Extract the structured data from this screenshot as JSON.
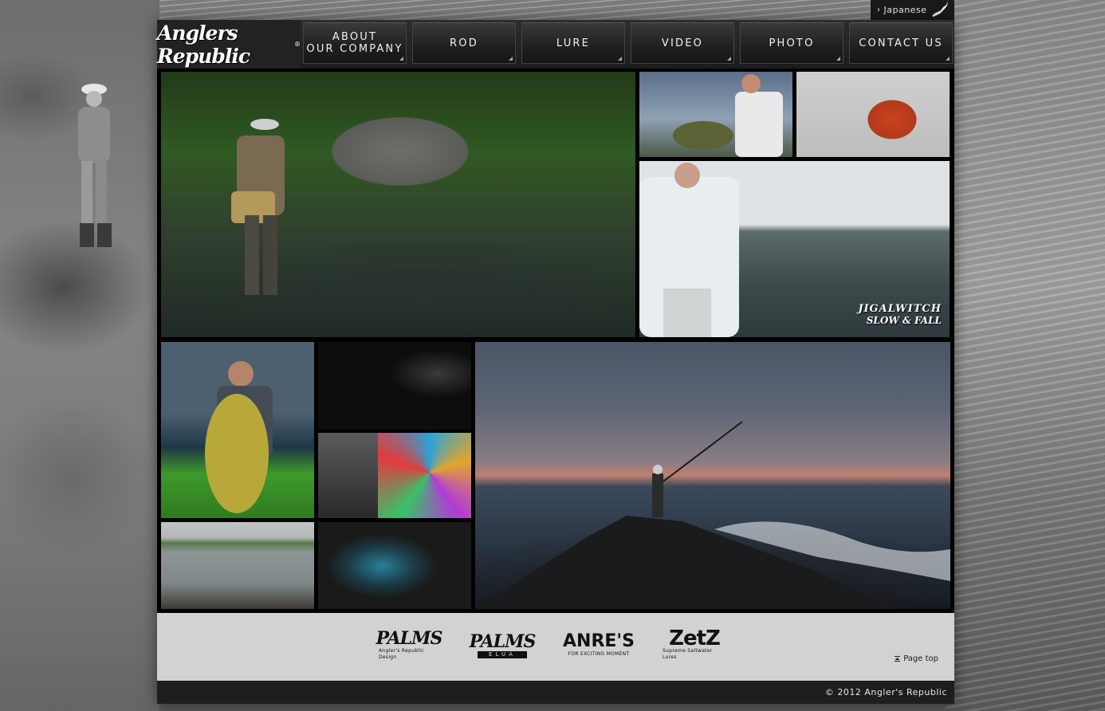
{
  "language_switch": {
    "label": "Japanese"
  },
  "header": {
    "logo_text": "Anglers Republic",
    "logo_mark": "®"
  },
  "nav": {
    "items": [
      {
        "label": "ABOUT\nOUR COMPANY"
      },
      {
        "label": "ROD"
      },
      {
        "label": "LURE"
      },
      {
        "label": "VIDEO"
      },
      {
        "label": "PHOTO"
      },
      {
        "label": "CONTACT US"
      }
    ]
  },
  "gallery": {
    "video_caption_top": "JIGALWITCH",
    "video_caption_bottom": "SLOW & FALL"
  },
  "brands": [
    {
      "name": "PALMS",
      "tagline": "Angler's Republic Design"
    },
    {
      "name": "PALMS",
      "tagline": "ELUA"
    },
    {
      "name": "ANRE'S",
      "tagline": "FOR EXCITING MOMENT"
    },
    {
      "name": "ZetZ",
      "tagline": "Supreme Saltwater Lures"
    }
  ],
  "page_top": {
    "label": "Page top"
  },
  "footer": {
    "copyright": "© 2012 Angler's Republic"
  },
  "colors": {
    "header_bg": "#1c1c1c",
    "brand_bar_bg": "#d2d2d2",
    "footer_bg": "#1e1e1e"
  }
}
